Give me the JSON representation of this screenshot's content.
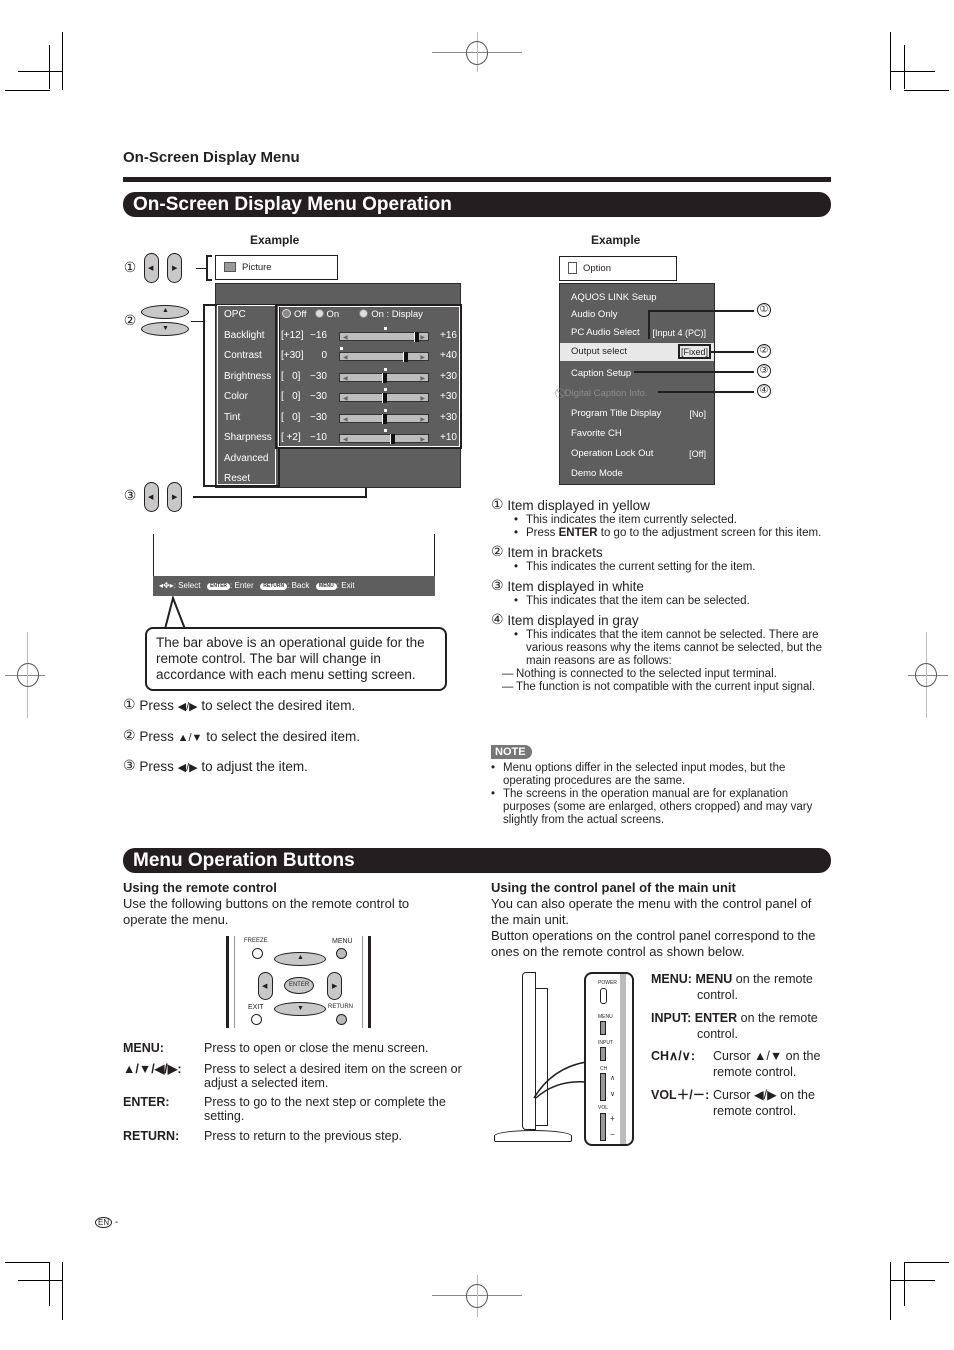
{
  "header": {
    "section_label": "On-Screen Display Menu"
  },
  "osd_operation": {
    "banner": "On-Screen Display Menu Operation",
    "left_example": {
      "label": "Example",
      "markers": [
        "①",
        "②",
        "③"
      ],
      "menu_title": "Picture",
      "items": [
        "OPC",
        "Backlight",
        "Contrast",
        "Brightness",
        "Color",
        "Tint",
        "Sharpness",
        "Advanced",
        "Reset"
      ],
      "opc_options": [
        "Off",
        "On",
        "On : Display"
      ],
      "opc_selected": "Off",
      "adjustments": [
        {
          "name": "Backlight",
          "current": "[+12]",
          "min": "−16",
          "max": "+16",
          "value": 12,
          "range": [
            -16,
            16
          ]
        },
        {
          "name": "Contrast",
          "current": "[+30]",
          "min": "0",
          "max": "+40",
          "value": 30,
          "range": [
            0,
            40
          ]
        },
        {
          "name": "Brightness",
          "current": "[   0]",
          "min": "−30",
          "max": "+30",
          "value": 0,
          "range": [
            -30,
            30
          ]
        },
        {
          "name": "Color",
          "current": "[   0]",
          "min": "−30",
          "max": "+30",
          "value": 0,
          "range": [
            -30,
            30
          ]
        },
        {
          "name": "Tint",
          "current": "[   0]",
          "min": "−30",
          "max": "+30",
          "value": 0,
          "range": [
            -30,
            30
          ]
        },
        {
          "name": "Sharpness",
          "current": "[ +2]",
          "min": "−10",
          "max": "+10",
          "value": 2,
          "range": [
            -10,
            10
          ]
        }
      ],
      "guide_bar": {
        "select": ": Select",
        "enter_btn": "ENTER",
        "enter": ": Enter",
        "return_btn": "RETURN",
        "back": ": Back",
        "menu_btn": "MENU",
        "exit": ": Exit"
      },
      "callout": "The bar above is an operational guide for the remote control. The bar will change in accordance with each menu setting screen.",
      "steps": [
        {
          "num": "①",
          "pre": "Press",
          "keys": "◀/▶",
          "post": "to select the desired item."
        },
        {
          "num": "②",
          "pre": "Press",
          "keys": "▲/▼",
          "post": "to select the desired item."
        },
        {
          "num": "③",
          "pre": "Press",
          "keys": "◀/▶",
          "post": "to adjust the item."
        }
      ]
    },
    "right_example": {
      "label": "Example",
      "menu_title": "Option",
      "items": [
        {
          "label": "AQUOS LINK Setup",
          "value": "",
          "state": "normal"
        },
        {
          "label": "Audio Only",
          "value": "",
          "state": "normal"
        },
        {
          "label": "PC Audio Select",
          "value": "[Input 4 (PC)]",
          "state": "normal"
        },
        {
          "label": "Output select",
          "value": "[Fixed]",
          "state": "selected"
        },
        {
          "label": "Caption Setup",
          "value": "",
          "state": "normal"
        },
        {
          "label": "Digital Caption Info.",
          "value": "",
          "state": "disabled"
        },
        {
          "label": "Program Title Display",
          "value": "[No]",
          "state": "normal"
        },
        {
          "label": "Favorite CH",
          "value": "",
          "state": "normal"
        },
        {
          "label": "Operation Lock Out",
          "value": "[Off]",
          "state": "normal"
        },
        {
          "label": "Demo Mode",
          "value": "",
          "state": "normal"
        }
      ],
      "markers": [
        "①",
        "②",
        "③",
        "④"
      ]
    },
    "legend": [
      {
        "num": "①",
        "title": "Item displayed in yellow",
        "bullets": [
          "This indicates the item currently selected.",
          "Press |ENTER| to go to the adjustment screen for this item."
        ]
      },
      {
        "num": "②",
        "title": "Item in brackets",
        "bullets": [
          "This indicates the current setting for the item."
        ]
      },
      {
        "num": "③",
        "title": "Item displayed in white",
        "bullets": [
          "This indicates that the item can be selected."
        ]
      },
      {
        "num": "④",
        "title": "Item displayed in gray",
        "bullets": [
          "This indicates that the item cannot be selected. There are various reasons why the items cannot be selected, but the main reasons are as follows:"
        ],
        "dashes": [
          "Nothing is connected to the selected input terminal.",
          "The function is not compatible with the current input signal."
        ]
      }
    ],
    "legend_enter_pre": "Press ",
    "legend_enter_bold": "ENTER",
    "legend_enter_post": " to go to the adjustment screen for this item.",
    "note": {
      "badge": "NOTE",
      "items": [
        "Menu options differ in the selected input modes, but the operating procedures are the same.",
        "The screens in the operation manual are for explanation purposes (some are enlarged, others cropped) and may vary slightly from the actual screens."
      ]
    }
  },
  "menu_buttons": {
    "banner": "Menu Operation Buttons",
    "remote": {
      "heading": "Using the remote control",
      "intro": "Use the following buttons on the remote control to operate the menu.",
      "button_labels": {
        "freeze": "FREEZE",
        "menu": "MENU",
        "enter": "ENTER",
        "exit": "EXIT",
        "return": "RETURN"
      },
      "definitions": [
        {
          "key": "MENU:",
          "desc": "Press to open or close the menu screen."
        },
        {
          "key": "▲/▼/◀/▶:",
          "desc": "Press to select a desired item on the screen or adjust a selected item."
        },
        {
          "key": "ENTER:",
          "desc": "Press to go to the next step or complete the setting."
        },
        {
          "key": "RETURN:",
          "desc": "Press to return to the previous step."
        }
      ]
    },
    "panel": {
      "heading": "Using the control panel of the main unit",
      "intro1": "You can also operate the menu with the control panel of the main unit.",
      "intro2": "Button operations on the control panel correspond to the ones on the remote control as shown below.",
      "panel_labels": {
        "power": "POWER",
        "menu": "MENU",
        "input": "INPUT",
        "ch": "CH",
        "vol": "VOL",
        "plus": "+",
        "minus": "−",
        "up": "∧",
        "down": "∨"
      },
      "definitions": [
        {
          "key": "MENU:",
          "bold": "MENU",
          "rest": " on the remote control."
        },
        {
          "key": "INPUT:",
          "bold": "ENTER",
          "rest": " on the remote control."
        },
        {
          "key": "CH∧/∨:",
          "bold": "",
          "rest": "Cursor ▲/▼ on the remote control."
        },
        {
          "key": "VOL＋/－:",
          "bold": "",
          "rest": "Cursor ◀/▶ on the remote control."
        }
      ]
    }
  },
  "footer": {
    "lang_badge": "EN",
    "page_suffix": "-"
  }
}
